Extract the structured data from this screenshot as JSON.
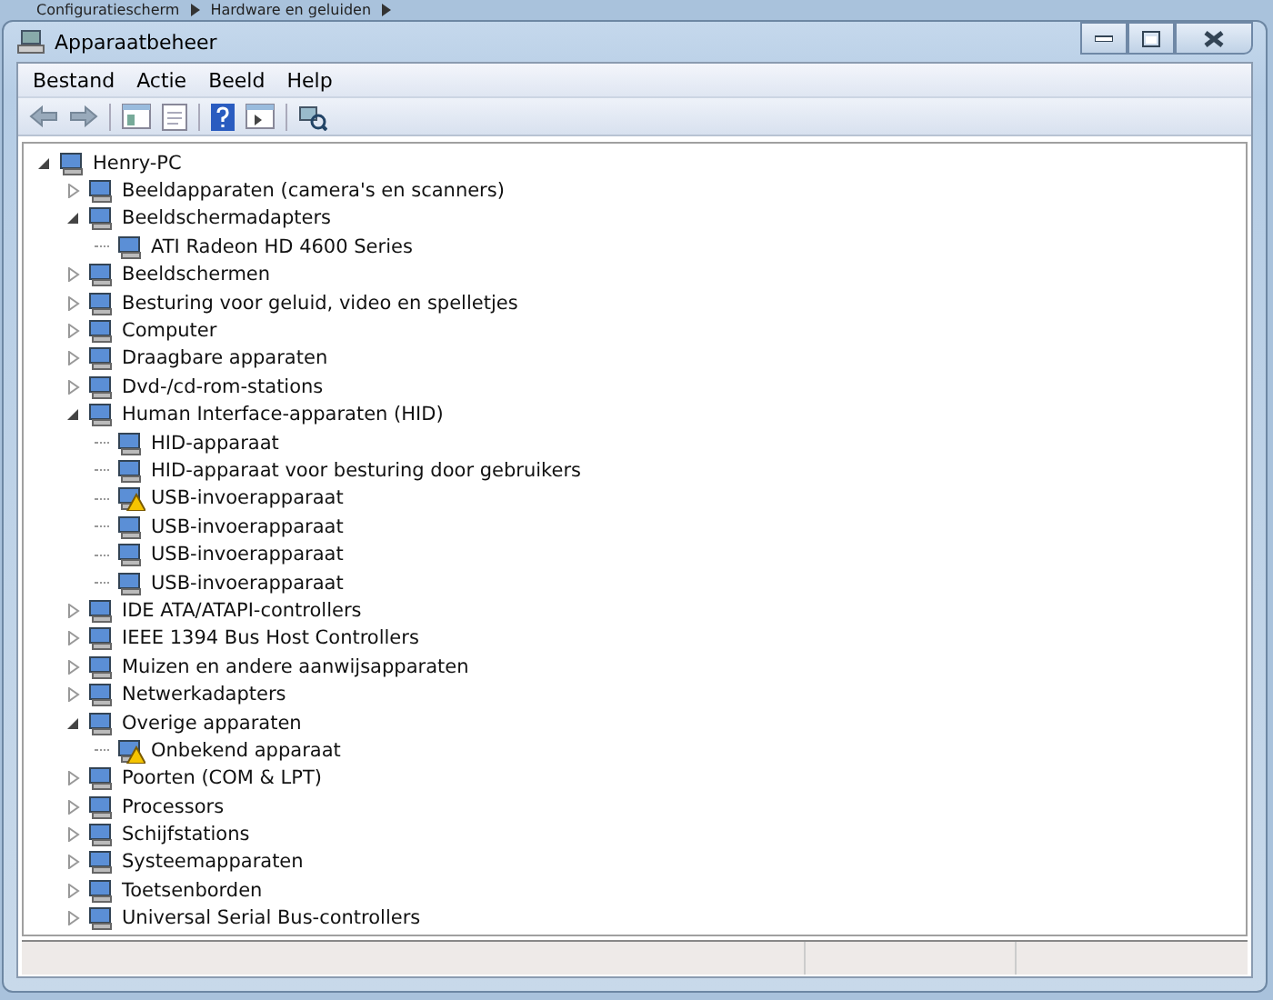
{
  "breadcrumb": [
    "Configuratiescherm",
    "Hardware en geluiden"
  ],
  "window": {
    "title": "Apparaatbeheer"
  },
  "menu": [
    "Bestand",
    "Actie",
    "Beeld",
    "Help"
  ],
  "tree": {
    "label": "Henry-PC",
    "expanded": true,
    "children": [
      {
        "label": "Beeldapparaten (camera's en scanners)",
        "expanded": false
      },
      {
        "label": "Beeldschermadapters",
        "expanded": true,
        "children": [
          {
            "label": "ATI Radeon HD 4600 Series",
            "warning": false
          }
        ]
      },
      {
        "label": "Beeldschermen",
        "expanded": false
      },
      {
        "label": "Besturing voor geluid, video en spelletjes",
        "expanded": false
      },
      {
        "label": "Computer",
        "expanded": false
      },
      {
        "label": "Draagbare apparaten",
        "expanded": false
      },
      {
        "label": "Dvd-/cd-rom-stations",
        "expanded": false
      },
      {
        "label": "Human Interface-apparaten (HID)",
        "expanded": true,
        "children": [
          {
            "label": "HID-apparaat",
            "warning": false
          },
          {
            "label": "HID-apparaat voor besturing door gebruikers",
            "warning": false
          },
          {
            "label": "USB-invoerapparaat",
            "warning": true
          },
          {
            "label": "USB-invoerapparaat",
            "warning": false
          },
          {
            "label": "USB-invoerapparaat",
            "warning": false
          },
          {
            "label": "USB-invoerapparaat",
            "warning": false
          }
        ]
      },
      {
        "label": "IDE ATA/ATAPI-controllers",
        "expanded": false
      },
      {
        "label": "IEEE 1394 Bus Host Controllers",
        "expanded": false
      },
      {
        "label": "Muizen en andere aanwijsapparaten",
        "expanded": false
      },
      {
        "label": "Netwerkadapters",
        "expanded": false
      },
      {
        "label": "Overige apparaten",
        "expanded": true,
        "children": [
          {
            "label": "Onbekend apparaat",
            "warning": true
          }
        ]
      },
      {
        "label": "Poorten (COM & LPT)",
        "expanded": false
      },
      {
        "label": "Processors",
        "expanded": false
      },
      {
        "label": "Schijfstations",
        "expanded": false
      },
      {
        "label": "Systeemapparaten",
        "expanded": false
      },
      {
        "label": "Toetsenborden",
        "expanded": false
      },
      {
        "label": "Universal Serial Bus-controllers",
        "expanded": false
      }
    ]
  }
}
